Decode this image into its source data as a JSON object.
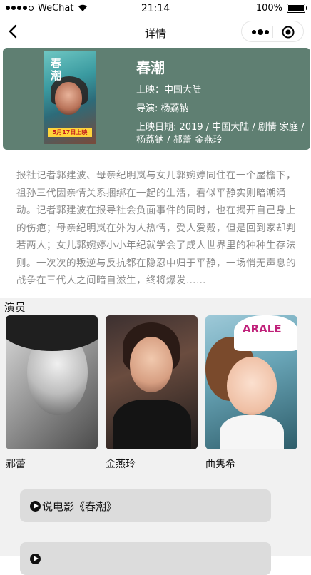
{
  "status": {
    "carrier": "WeChat",
    "time": "21:14",
    "battery": "100%"
  },
  "nav": {
    "title": "详情"
  },
  "movie": {
    "title": "春潮",
    "release_line": "上映：中国大陆",
    "director_line": "导演: 杨荔钠",
    "date_line": "上映日期:  2019 / 中国大陆 / 剧情 家庭 / 杨荔钠 / 郝蕾 金燕玲",
    "poster": {
      "title": "春潮",
      "date": "5月17日上映"
    }
  },
  "synopsis": "报社记者郭建波、母亲纪明岚与女儿郭婉婷同住在一个屋檐下，祖孙三代因亲情关系捆绑在一起的生活，看似平静实则暗潮涌动。记者郭建波在报导社会负面事件的同时，也在揭开自己身上的伤疤；母亲纪明岚在外为人热情，受人爱戴，但是回到家却判若两人；女儿郭婉婷小小年纪就学会了成人世界里的种种生存法则。一次次的叛逆与反抗都在隐忍中归于平静，一场悄无声息的战争在三代人之间暗自滋生，终将爆发……",
  "cast": {
    "section_title": "演员",
    "actors": [
      {
        "name": "郝蕾"
      },
      {
        "name": "金燕玲"
      },
      {
        "name": "曲隽希"
      }
    ]
  },
  "buttons": [
    {
      "label": "说电影《春潮》"
    }
  ],
  "icons": {
    "back": "chevron-left-icon",
    "more": "more-dots-icon",
    "target": "target-icon",
    "play": "play-icon"
  },
  "colors": {
    "card_bg": "#5f7f72",
    "lower_bg": "#f1f1f1",
    "button_bg": "#dcdcdc"
  }
}
